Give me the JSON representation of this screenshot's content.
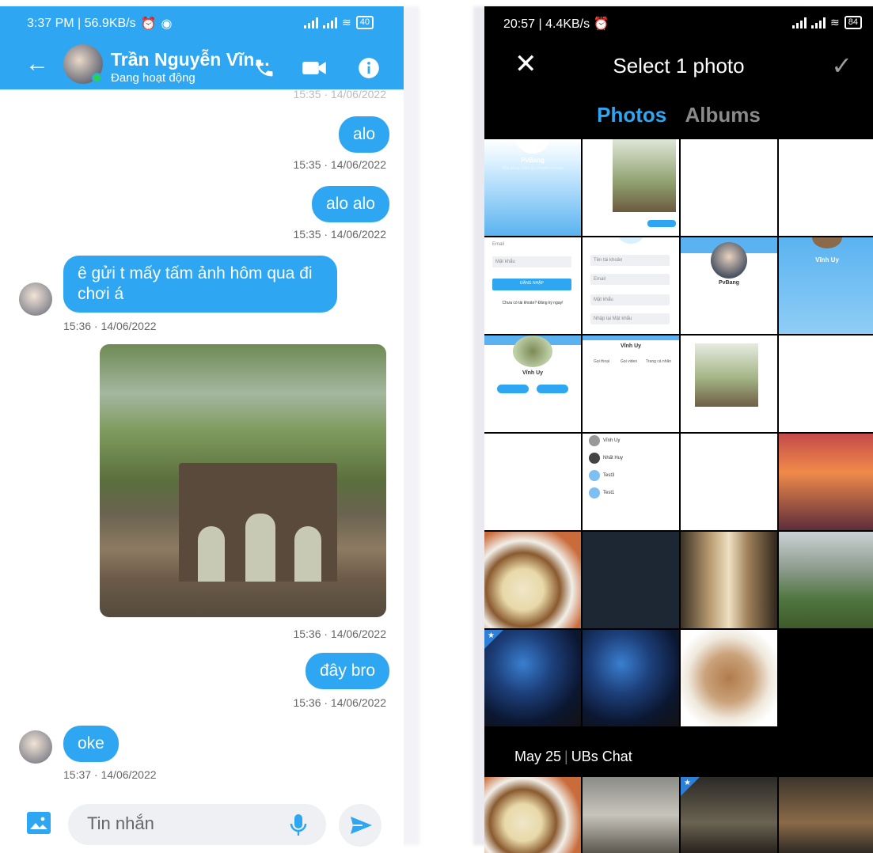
{
  "left": {
    "status": {
      "time": "3:37 PM | 56.9KB/s",
      "battery": "40"
    },
    "header": {
      "name": "Trần Nguyễn Vĩn...",
      "status": "Đang hoạt động"
    },
    "messages": [
      {
        "side": "right",
        "text": "alo",
        "time": "15:35 · 14/06/2022"
      },
      {
        "side": "right",
        "text": "alo alo",
        "time": "15:35 · 14/06/2022"
      },
      {
        "side": "left",
        "text": "ê gửi t mấy tấm ảnh hôm qua đi chơi á",
        "time": "15:36 · 14/06/2022"
      },
      {
        "side": "right",
        "type": "image",
        "time": "15:36 · 14/06/2022"
      },
      {
        "side": "right",
        "text": "đây bro",
        "time": "15:36 · 14/06/2022"
      },
      {
        "side": "left",
        "text": "oke",
        "time": "15:37 · 14/06/2022"
      }
    ],
    "composer": {
      "placeholder": "Tin nhắn"
    }
  },
  "right": {
    "status": {
      "time": "20:57 | 4.4KB/s",
      "battery": "84"
    },
    "title": "Select 1 photo",
    "tabs": {
      "photos": "Photos",
      "albums": "Albums"
    },
    "grid": {
      "c1_name": "PvBang",
      "c1_sub": "Hãy dùng nhiều tin chuyện với bạn",
      "email": "Email",
      "password": "Mật khẩu",
      "login_btn": "ĐĂNG NHẬP",
      "signup_text": "Chưa có tài khoản? Đăng ký ngay!",
      "username": "Tên tài khoản",
      "confirm_password": "Nhập lại Mật khẩu",
      "pvbang": "PvBang",
      "vinhuy": "Vĩnh Uy",
      "contacts": [
        "Vĩnh Uy",
        "Nhất Huy",
        "Test3",
        "Test1"
      ],
      "call_labels": [
        "Gọi thoại",
        "Gọi video",
        "Trang cá nhân"
      ]
    },
    "section_date": "May 25",
    "section_album": "UBs Chat",
    "colors": {
      "accent": "#2ea6f1",
      "bg": "#000000"
    }
  }
}
